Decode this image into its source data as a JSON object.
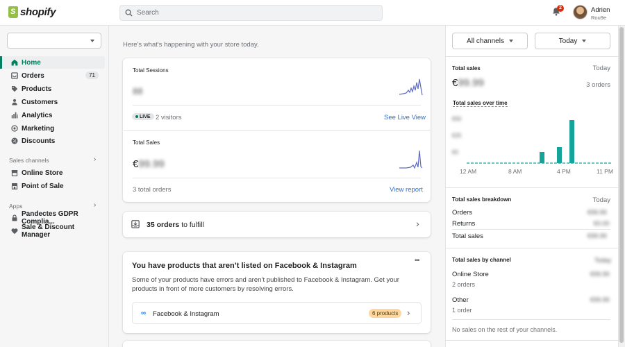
{
  "topbar": {
    "logo_text": "shopify",
    "search_placeholder": "Search",
    "notification_count": "2",
    "user_name": "Adrien",
    "user_store": "Rou9e"
  },
  "sidebar": {
    "nav": [
      {
        "label": "Home",
        "icon": "home-icon",
        "active": true
      },
      {
        "label": "Orders",
        "icon": "orders-icon",
        "badge": "71"
      },
      {
        "label": "Products",
        "icon": "tag-icon"
      },
      {
        "label": "Customers",
        "icon": "person-icon"
      },
      {
        "label": "Analytics",
        "icon": "bar-chart-icon"
      },
      {
        "label": "Marketing",
        "icon": "target-icon"
      },
      {
        "label": "Discounts",
        "icon": "discount-icon"
      }
    ],
    "sales_channels_label": "Sales channels",
    "channels": [
      {
        "label": "Online Store",
        "icon": "store-icon"
      },
      {
        "label": "Point of Sale",
        "icon": "pos-icon"
      }
    ],
    "apps_label": "Apps",
    "apps": [
      {
        "label": "Pandectes GDPR Complia...",
        "icon": "lock-icon"
      },
      {
        "label": "Sale & Discount Manager",
        "icon": "heart-icon"
      }
    ]
  },
  "main": {
    "intro": "Here's what's happening with your store today.",
    "sessions": {
      "title": "Total Sessions",
      "live_label": "LIVE",
      "visitors": "2 visitors",
      "live_link": "See Live View"
    },
    "sales": {
      "title": "Total Sales",
      "currency": "€",
      "orders": "3 total orders",
      "link": "View report"
    },
    "fulfill": {
      "count": "35 orders",
      "suffix": "to fulfill"
    },
    "fb": {
      "title": "You have products that aren’t listed on Facebook & Instagram",
      "body": "Some of your products have errors and aren’t published to Facebook & Instagram. Get your products in front of more customers by resolving errors.",
      "channel": "Facebook & Instagram",
      "badge": "6 products",
      "menu": "•••"
    }
  },
  "right": {
    "channel_button": "All channels",
    "date_button": "Today",
    "total_sales": {
      "title": "Total sales",
      "period": "Today",
      "currency": "€",
      "orders": "3 orders"
    },
    "over_time": {
      "title": "Total sales over time",
      "x_labels": [
        "12 AM",
        "8 AM",
        "4 PM",
        "11 PM"
      ]
    },
    "breakdown": {
      "title": "Total sales breakdown",
      "period": "Today",
      "rows": [
        "Orders",
        "Returns",
        "Total sales"
      ]
    },
    "by_channel": {
      "title": "Total sales by channel",
      "channels": [
        {
          "name": "Online Store",
          "orders": "2 orders"
        },
        {
          "name": "Other",
          "orders": "1 order"
        }
      ],
      "note": "No sales on the rest of your channels."
    }
  },
  "colors": {
    "accent": "#008060",
    "bar": "#14a49a",
    "link": "#2c6ecb",
    "spark": "#5c6ac4",
    "badge_warn": "#ffd79d"
  }
}
